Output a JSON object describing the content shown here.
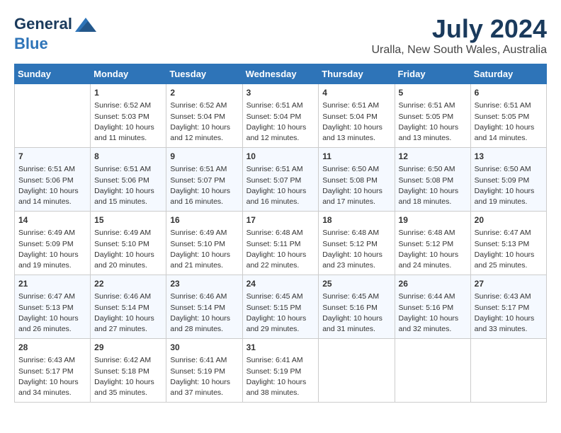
{
  "header": {
    "logo_line1": "General",
    "logo_line2": "Blue",
    "month_year": "July 2024",
    "location": "Uralla, New South Wales, Australia"
  },
  "days_of_week": [
    "Sunday",
    "Monday",
    "Tuesday",
    "Wednesday",
    "Thursday",
    "Friday",
    "Saturday"
  ],
  "weeks": [
    [
      {
        "day": "",
        "sunrise": "",
        "sunset": "",
        "daylight": ""
      },
      {
        "day": "1",
        "sunrise": "Sunrise: 6:52 AM",
        "sunset": "Sunset: 5:03 PM",
        "daylight": "Daylight: 10 hours and 11 minutes."
      },
      {
        "day": "2",
        "sunrise": "Sunrise: 6:52 AM",
        "sunset": "Sunset: 5:04 PM",
        "daylight": "Daylight: 10 hours and 12 minutes."
      },
      {
        "day": "3",
        "sunrise": "Sunrise: 6:51 AM",
        "sunset": "Sunset: 5:04 PM",
        "daylight": "Daylight: 10 hours and 12 minutes."
      },
      {
        "day": "4",
        "sunrise": "Sunrise: 6:51 AM",
        "sunset": "Sunset: 5:04 PM",
        "daylight": "Daylight: 10 hours and 13 minutes."
      },
      {
        "day": "5",
        "sunrise": "Sunrise: 6:51 AM",
        "sunset": "Sunset: 5:05 PM",
        "daylight": "Daylight: 10 hours and 13 minutes."
      },
      {
        "day": "6",
        "sunrise": "Sunrise: 6:51 AM",
        "sunset": "Sunset: 5:05 PM",
        "daylight": "Daylight: 10 hours and 14 minutes."
      }
    ],
    [
      {
        "day": "7",
        "sunrise": "Sunrise: 6:51 AM",
        "sunset": "Sunset: 5:06 PM",
        "daylight": "Daylight: 10 hours and 14 minutes."
      },
      {
        "day": "8",
        "sunrise": "Sunrise: 6:51 AM",
        "sunset": "Sunset: 5:06 PM",
        "daylight": "Daylight: 10 hours and 15 minutes."
      },
      {
        "day": "9",
        "sunrise": "Sunrise: 6:51 AM",
        "sunset": "Sunset: 5:07 PM",
        "daylight": "Daylight: 10 hours and 16 minutes."
      },
      {
        "day": "10",
        "sunrise": "Sunrise: 6:51 AM",
        "sunset": "Sunset: 5:07 PM",
        "daylight": "Daylight: 10 hours and 16 minutes."
      },
      {
        "day": "11",
        "sunrise": "Sunrise: 6:50 AM",
        "sunset": "Sunset: 5:08 PM",
        "daylight": "Daylight: 10 hours and 17 minutes."
      },
      {
        "day": "12",
        "sunrise": "Sunrise: 6:50 AM",
        "sunset": "Sunset: 5:08 PM",
        "daylight": "Daylight: 10 hours and 18 minutes."
      },
      {
        "day": "13",
        "sunrise": "Sunrise: 6:50 AM",
        "sunset": "Sunset: 5:09 PM",
        "daylight": "Daylight: 10 hours and 19 minutes."
      }
    ],
    [
      {
        "day": "14",
        "sunrise": "Sunrise: 6:49 AM",
        "sunset": "Sunset: 5:09 PM",
        "daylight": "Daylight: 10 hours and 19 minutes."
      },
      {
        "day": "15",
        "sunrise": "Sunrise: 6:49 AM",
        "sunset": "Sunset: 5:10 PM",
        "daylight": "Daylight: 10 hours and 20 minutes."
      },
      {
        "day": "16",
        "sunrise": "Sunrise: 6:49 AM",
        "sunset": "Sunset: 5:10 PM",
        "daylight": "Daylight: 10 hours and 21 minutes."
      },
      {
        "day": "17",
        "sunrise": "Sunrise: 6:48 AM",
        "sunset": "Sunset: 5:11 PM",
        "daylight": "Daylight: 10 hours and 22 minutes."
      },
      {
        "day": "18",
        "sunrise": "Sunrise: 6:48 AM",
        "sunset": "Sunset: 5:12 PM",
        "daylight": "Daylight: 10 hours and 23 minutes."
      },
      {
        "day": "19",
        "sunrise": "Sunrise: 6:48 AM",
        "sunset": "Sunset: 5:12 PM",
        "daylight": "Daylight: 10 hours and 24 minutes."
      },
      {
        "day": "20",
        "sunrise": "Sunrise: 6:47 AM",
        "sunset": "Sunset: 5:13 PM",
        "daylight": "Daylight: 10 hours and 25 minutes."
      }
    ],
    [
      {
        "day": "21",
        "sunrise": "Sunrise: 6:47 AM",
        "sunset": "Sunset: 5:13 PM",
        "daylight": "Daylight: 10 hours and 26 minutes."
      },
      {
        "day": "22",
        "sunrise": "Sunrise: 6:46 AM",
        "sunset": "Sunset: 5:14 PM",
        "daylight": "Daylight: 10 hours and 27 minutes."
      },
      {
        "day": "23",
        "sunrise": "Sunrise: 6:46 AM",
        "sunset": "Sunset: 5:14 PM",
        "daylight": "Daylight: 10 hours and 28 minutes."
      },
      {
        "day": "24",
        "sunrise": "Sunrise: 6:45 AM",
        "sunset": "Sunset: 5:15 PM",
        "daylight": "Daylight: 10 hours and 29 minutes."
      },
      {
        "day": "25",
        "sunrise": "Sunrise: 6:45 AM",
        "sunset": "Sunset: 5:16 PM",
        "daylight": "Daylight: 10 hours and 31 minutes."
      },
      {
        "day": "26",
        "sunrise": "Sunrise: 6:44 AM",
        "sunset": "Sunset: 5:16 PM",
        "daylight": "Daylight: 10 hours and 32 minutes."
      },
      {
        "day": "27",
        "sunrise": "Sunrise: 6:43 AM",
        "sunset": "Sunset: 5:17 PM",
        "daylight": "Daylight: 10 hours and 33 minutes."
      }
    ],
    [
      {
        "day": "28",
        "sunrise": "Sunrise: 6:43 AM",
        "sunset": "Sunset: 5:17 PM",
        "daylight": "Daylight: 10 hours and 34 minutes."
      },
      {
        "day": "29",
        "sunrise": "Sunrise: 6:42 AM",
        "sunset": "Sunset: 5:18 PM",
        "daylight": "Daylight: 10 hours and 35 minutes."
      },
      {
        "day": "30",
        "sunrise": "Sunrise: 6:41 AM",
        "sunset": "Sunset: 5:19 PM",
        "daylight": "Daylight: 10 hours and 37 minutes."
      },
      {
        "day": "31",
        "sunrise": "Sunrise: 6:41 AM",
        "sunset": "Sunset: 5:19 PM",
        "daylight": "Daylight: 10 hours and 38 minutes."
      },
      {
        "day": "",
        "sunrise": "",
        "sunset": "",
        "daylight": ""
      },
      {
        "day": "",
        "sunrise": "",
        "sunset": "",
        "daylight": ""
      },
      {
        "day": "",
        "sunrise": "",
        "sunset": "",
        "daylight": ""
      }
    ]
  ]
}
